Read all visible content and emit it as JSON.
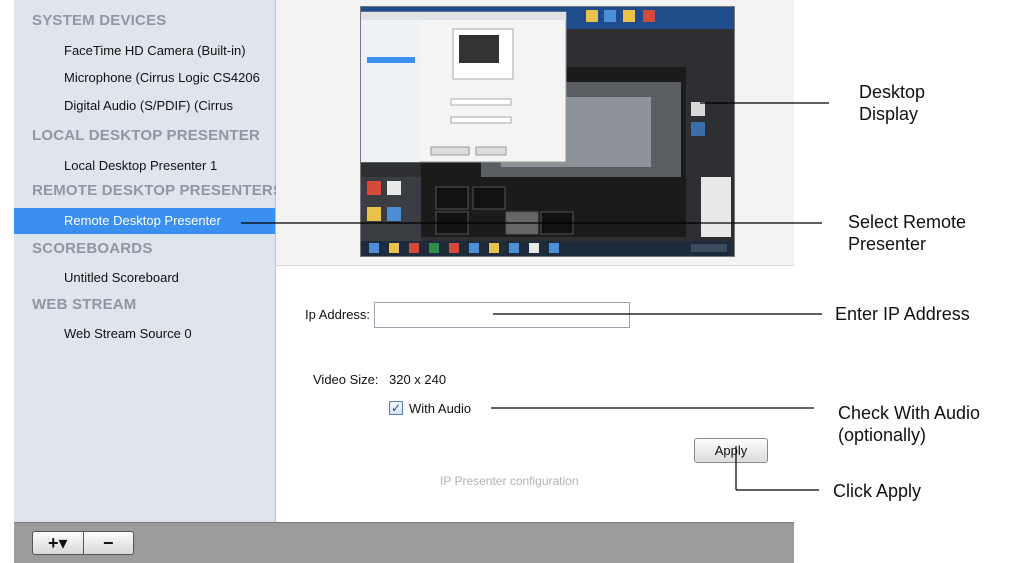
{
  "sidebar": {
    "sections": [
      {
        "title": "SYSTEM DEVICES",
        "items": [
          "FaceTime HD Camera (Built-in)",
          "Microphone (Cirrus Logic CS4206",
          "Digital Audio (S/PDIF) (Cirrus"
        ]
      },
      {
        "title": "LOCAL DESKTOP PRESENTER",
        "items": [
          "Local Desktop Presenter 1"
        ]
      },
      {
        "title": "REMOTE DESKTOP PRESENTERS",
        "items": [
          "Remote Desktop Presenter"
        ]
      },
      {
        "title": "SCOREBOARDS",
        "items": [
          "Untitled Scoreboard"
        ]
      },
      {
        "title": "WEB STREAM",
        "items": [
          "Web Stream Source 0"
        ]
      }
    ],
    "selected_item": "Remote Desktop Presenter"
  },
  "toolbar": {
    "add_label": "+▾",
    "remove_label": "−"
  },
  "form": {
    "ip_label": "Ip Address:",
    "ip_value": "",
    "video_size_label": "Video Size:",
    "video_size_value": "320 x 240",
    "with_audio_label": "With Audio",
    "with_audio_checked": true,
    "apply_label": "Apply",
    "caption": "IP Presenter configuration"
  },
  "callouts": {
    "desktop_display": [
      "Desktop",
      "Display"
    ],
    "select_remote": [
      "Select Remote",
      "Presenter"
    ],
    "enter_ip": "Enter IP Address",
    "check_audio": [
      "Check With Audio",
      "(optionally)"
    ],
    "click_apply": "Click Apply"
  }
}
